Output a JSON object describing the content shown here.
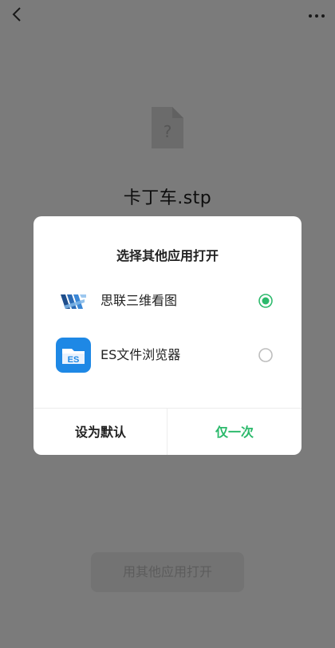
{
  "file": {
    "name": "卡丁车.stp"
  },
  "bottom_button": {
    "label": "用其他应用打开"
  },
  "dialog": {
    "title": "选择其他应用打开",
    "options": [
      {
        "label": "思联三维看图",
        "icon": "silian-3d-viewer-icon",
        "selected": true
      },
      {
        "label": "ES文件浏览器",
        "icon": "es-file-explorer-icon",
        "selected": false
      }
    ],
    "buttons": {
      "set_default": "设为默认",
      "just_once": "仅一次"
    }
  },
  "colors": {
    "accent": "#2bb96b",
    "overlay": "rgba(0,0,0,0.5)"
  }
}
